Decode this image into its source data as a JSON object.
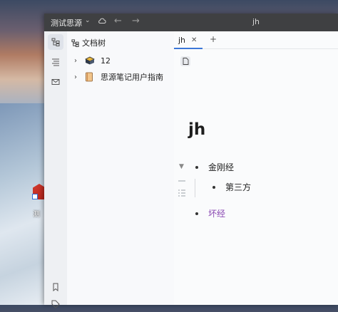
{
  "desktop": {
    "shortcut_label": "测"
  },
  "titlebar": {
    "workspace": "测试思源",
    "doc_title": "jh"
  },
  "dock": {
    "items": [
      "file-tree",
      "outline",
      "inbox",
      "bookmark",
      "tag"
    ]
  },
  "tree": {
    "header": "文档树",
    "items": [
      {
        "name": "12",
        "emoji": "box"
      },
      {
        "name": "思源笔记用户指南",
        "emoji": "notebook"
      }
    ]
  },
  "editor": {
    "tabs": [
      {
        "label": "jh",
        "active": true
      }
    ],
    "title": "jh",
    "blocks": [
      {
        "text": "金刚经",
        "level": 0
      },
      {
        "text": "第三方",
        "level": 1
      },
      {
        "text": "坏经",
        "level": 0,
        "link": true
      }
    ]
  },
  "colors": {
    "accent": "#3b77d8",
    "titlebar": "#3f4042",
    "link": "#8b4ab3"
  }
}
